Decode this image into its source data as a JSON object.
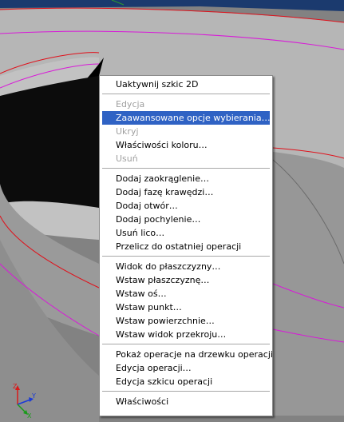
{
  "context_menu": {
    "groups": [
      [
        {
          "label": "Uaktywnij szkic 2D",
          "enabled": true
        }
      ],
      [
        {
          "label": "Edycja",
          "enabled": false
        },
        {
          "label": "Zaawansowane opcje wybierania…",
          "enabled": true,
          "highlighted": true
        },
        {
          "label": "Ukryj",
          "enabled": false
        },
        {
          "label": "Właściwości koloru…",
          "enabled": true
        },
        {
          "label": "Usuń",
          "enabled": false
        }
      ],
      [
        {
          "label": "Dodaj zaokrąglenie…",
          "enabled": true
        },
        {
          "label": "Dodaj fazę krawędzi…",
          "enabled": true
        },
        {
          "label": "Dodaj otwór…",
          "enabled": true
        },
        {
          "label": "Dodaj pochylenie…",
          "enabled": true
        },
        {
          "label": "Usuń lico…",
          "enabled": true
        },
        {
          "label": "Przelicz do ostatniej operacji",
          "enabled": true
        }
      ],
      [
        {
          "label": "Widok do płaszczyzny…",
          "enabled": true
        },
        {
          "label": "Wstaw płaszczyznę…",
          "enabled": true
        },
        {
          "label": "Wstaw oś…",
          "enabled": true
        },
        {
          "label": "Wstaw punkt…",
          "enabled": true
        },
        {
          "label": "Wstaw powierzchnie…",
          "enabled": true
        },
        {
          "label": "Wstaw widok przekroju…",
          "enabled": true
        }
      ],
      [
        {
          "label": "Pokaż operacje na drzewku operacji",
          "enabled": true
        },
        {
          "label": "Edycja operacji…",
          "enabled": true
        },
        {
          "label": "Edycja szkicu operacji",
          "enabled": true
        }
      ],
      [
        {
          "label": "Właściwości",
          "enabled": true
        }
      ]
    ]
  },
  "triad": {
    "z_label": "Z",
    "x_label": "X",
    "y_label": "Y"
  },
  "colors": {
    "background_top": "#1b3a6e",
    "model_face": "#8c8c8c",
    "model_dark": "#000000",
    "edge_red": "#e0101a",
    "edge_magenta": "#d81ad8",
    "menu_highlight": "#2f62c4",
    "menu_disabled_text": "#a0a0a0"
  }
}
